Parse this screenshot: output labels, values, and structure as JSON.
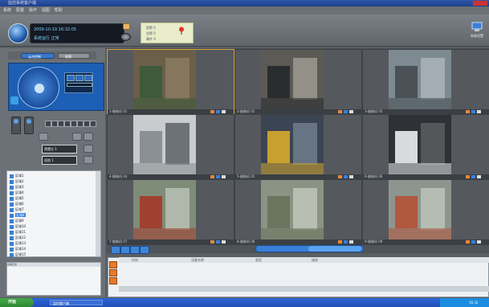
{
  "window": {
    "title": "监控系统客户端"
  },
  "menu": [
    "系统",
    "配置",
    "操作",
    "视图",
    "帮助"
  ],
  "header": {
    "info_line1": "2009-10-19 16:32:05",
    "info_line2": "系统运行 正常",
    "system_label": "系统设置",
    "alarm_lines": [
      "报警 0",
      "告警 0",
      "事件 0"
    ]
  },
  "left_panel": {
    "ptz_tab1": "云台控制",
    "ptz_tab2": "视频",
    "select1": "预置位 1",
    "select2": "巡航 1"
  },
  "tree_items": [
    "区域1",
    "区域2",
    "区域3",
    "区域4",
    "区域5",
    "区域6",
    "区域7",
    "区域8",
    "区域9",
    "区域10",
    "区域11",
    "区域12",
    "区域13",
    "区域14",
    "区域15"
  ],
  "tree_selected_index": 7,
  "log": {
    "header": "系统日志"
  },
  "cameras": [
    {
      "label": "1-摄像机 01",
      "active": true
    },
    {
      "label": "2-摄像机 02",
      "active": false
    },
    {
      "label": "3-摄像机 03",
      "active": false
    },
    {
      "label": "4-摄像机 04",
      "active": false
    },
    {
      "label": "5-摄像机 05",
      "active": false
    },
    {
      "label": "6-摄像机 06",
      "active": false
    },
    {
      "label": "7-摄像机 07",
      "active": false
    },
    {
      "label": "8-摄像机 08",
      "active": false
    },
    {
      "label": "9-摄像机 09",
      "active": false
    }
  ],
  "events": {
    "columns": [
      "时间",
      "设备名称",
      "类型",
      "描述"
    ]
  },
  "taskbar": {
    "start": "开始",
    "app": "监控客户端",
    "clock": "16:32"
  },
  "colors": {
    "accent": "#3a7fd8",
    "active_border": "#d7a640",
    "alarm_bg": "#e9edc9"
  }
}
